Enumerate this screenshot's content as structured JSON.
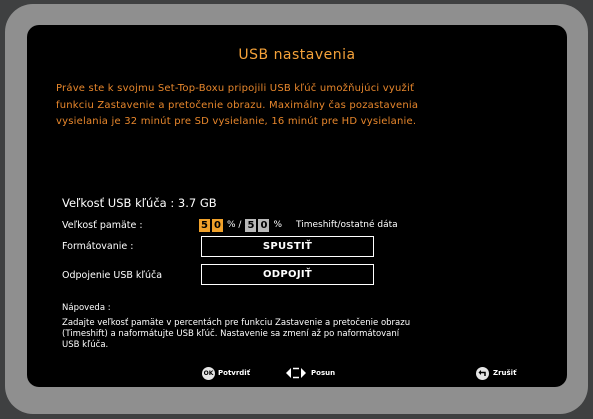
{
  "dialog": {
    "title": "USB nastavenia",
    "intro": "Práve ste k svojmu Set-Top-Boxu pripojili USB kľúč umožňujúci využiť\nfunkciu Zastavenie a pretočenie obrazu. Maximálny čas pozastavenia\nvysielania je 32 minút pre SD vysielanie, 16 minút pre HD vysielanie."
  },
  "usb": {
    "size_label": "Veľkosť USB kľúča : 3.7 GB"
  },
  "memory": {
    "label": "Veľkosť pamäte :",
    "timeshift_digits": [
      "5",
      "0"
    ],
    "separator": "% /",
    "other_digits": [
      "5",
      "0"
    ],
    "percent": "%",
    "note": "Timeshift/ostatné dáta"
  },
  "format": {
    "label": "Formátovanie :",
    "button": "SPUSTIŤ"
  },
  "disconnect": {
    "label": "Odpojenie USB kľúča",
    "button": "ODPOJIŤ"
  },
  "help": {
    "title": "Nápoveda :",
    "text": "Zadajte veľkosť pamäte v percentách pre funkciu Zastavenie a pretočenie obrazu\n(Timeshift) a naformátujte USB kľúč. Nastavenie sa zmení až po naformátovaní\nUSB kľúča."
  },
  "footer": {
    "ok_icon": "ok-icon",
    "ok_key": "OK",
    "ok_label": "Potvrdiť",
    "nav_icon": "left-right-arrows-icon",
    "nav_label": "Posun",
    "back_icon": "back-icon",
    "back_label": "Zrušiť"
  },
  "colors": {
    "title": "#f5a23a",
    "intro": "#e8872c",
    "active_field": "#f0a12a",
    "inactive_field": "#b9b9b9",
    "bezel": "#8f8f8f"
  }
}
